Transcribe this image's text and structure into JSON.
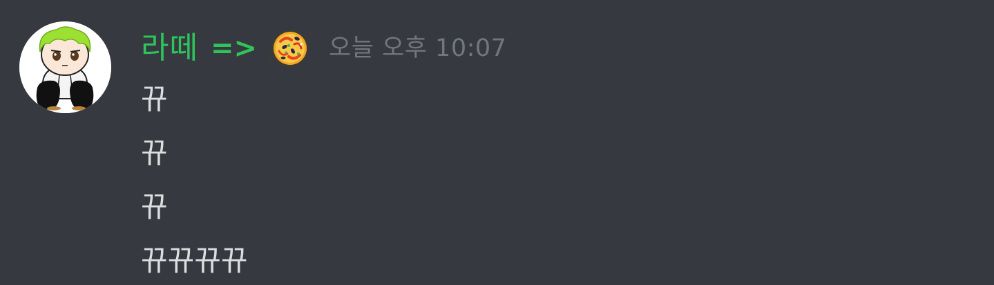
{
  "message": {
    "author": {
      "name": "라떼",
      "suffix": "=>",
      "name_color": "#2ec45a",
      "emoji": "paella-emoji-icon"
    },
    "timestamp": "오늘 오후 10:07",
    "lines": [
      "뀨",
      "뀨",
      "뀨",
      "뀨뀨뀨뀨"
    ]
  },
  "colors": {
    "background": "#36393f",
    "text": "#dcddde",
    "timestamp": "#72767d"
  }
}
